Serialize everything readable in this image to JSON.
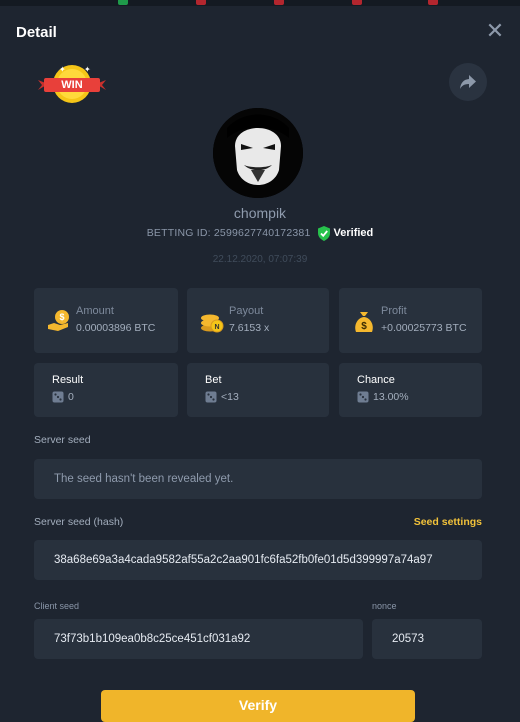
{
  "colors": {
    "background": "#1e2530",
    "card": "#28313d",
    "accent": "#f2c23a",
    "verified_green": "#27c24c"
  },
  "header": {
    "title": "Detail",
    "close_icon": "close-icon"
  },
  "badge": {
    "text": "WIN"
  },
  "share": {
    "icon": "share-arrow-icon"
  },
  "user": {
    "name": "chompik",
    "betting_id": "BETTING ID: 2599627740172381",
    "verified_label": "Verified",
    "date": "22.12.2020, 07:07:39"
  },
  "stats": [
    {
      "label": "Amount",
      "value": "0.00003896 BTC",
      "icon": "coin-hand-icon"
    },
    {
      "label": "Payout",
      "value": "7.6153 x",
      "icon": "coin-stack-icon"
    },
    {
      "label": "Profit",
      "value": "+0.00025773 BTC",
      "icon": "money-bag-icon"
    }
  ],
  "bet_info": [
    {
      "label": "Result",
      "value": "0",
      "icon": "dice-icon"
    },
    {
      "label": "Bet",
      "value": "<13",
      "icon": "dice-icon"
    },
    {
      "label": "Chance",
      "value": "13.00%",
      "icon": "dice-icon"
    }
  ],
  "server_seed": {
    "label": "Server seed",
    "value": "The seed hasn't been revealed yet."
  },
  "server_seed_hash": {
    "label": "Server seed (hash)",
    "settings_link": "Seed settings",
    "value": "38a68e69a3a4cada9582af55a2c2aa901fc6fa52fb0fe01d5d399997a74a97"
  },
  "client_seed": {
    "label": "Client seed",
    "value": "73f73b1b109ea0b8c25ce451cf031a92"
  },
  "nonce": {
    "label": "nonce",
    "value": "20573"
  },
  "verify_button": {
    "label": "Verify"
  }
}
